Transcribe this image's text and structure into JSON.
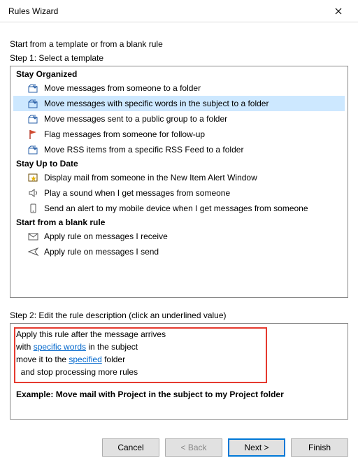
{
  "window": {
    "title": "Rules Wizard"
  },
  "intro": "Start from a template or from a blank rule",
  "step1_label": "Step 1: Select a template",
  "sections": {
    "stay_organized": {
      "header": "Stay Organized",
      "items": [
        "Move messages from someone to a folder",
        "Move messages with specific words in the subject to a folder",
        "Move messages sent to a public group to a folder",
        "Flag messages from someone for follow-up",
        "Move RSS items from a specific RSS Feed to a folder"
      ],
      "selected_index": 1
    },
    "stay_up_to_date": {
      "header": "Stay Up to Date",
      "items": [
        "Display mail from someone in the New Item Alert Window",
        "Play a sound when I get messages from someone",
        "Send an alert to my mobile device when I get messages from someone"
      ]
    },
    "blank_rule": {
      "header": "Start from a blank rule",
      "items": [
        "Apply rule on messages I receive",
        "Apply rule on messages I send"
      ]
    }
  },
  "step2_label": "Step 2: Edit the rule description (click an underlined value)",
  "description": {
    "line1": "Apply this rule after the message arrives",
    "line2_prefix": "with ",
    "line2_link": "specific words",
    "line2_suffix": " in the subject",
    "line3_prefix": "move it to the ",
    "line3_link": "specified",
    "line3_suffix": " folder",
    "line4": "  and stop processing more rules",
    "example": "Example: Move mail with Project in the subject to my Project folder"
  },
  "buttons": {
    "cancel": "Cancel",
    "back": "< Back",
    "next": "Next >",
    "finish": "Finish"
  }
}
